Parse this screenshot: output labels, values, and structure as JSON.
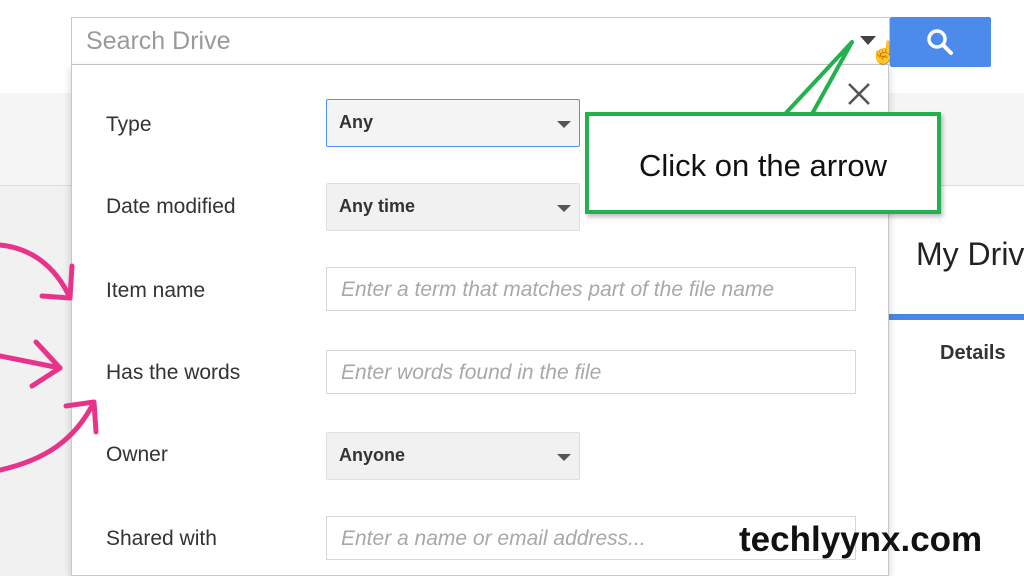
{
  "search": {
    "placeholder": "Search Drive",
    "icons": {
      "options_arrow": "caret-down-icon",
      "cursor": "hand-pointer-icon",
      "submit": "search-icon"
    },
    "button_color": "#4d8bea"
  },
  "advanced_search": {
    "close_icon": "close-icon",
    "fields": {
      "type": {
        "label": "Type",
        "value": "Any"
      },
      "date_modified": {
        "label": "Date modified",
        "value": "Any time"
      },
      "item_name": {
        "label": "Item name",
        "placeholder": "Enter a term that matches part of the file name"
      },
      "has_words": {
        "label": "Has the words",
        "placeholder": "Enter words found in the file"
      },
      "owner": {
        "label": "Owner",
        "value": "Anyone"
      },
      "shared_with": {
        "label": "Shared with",
        "placeholder": "Enter a name or email address..."
      }
    }
  },
  "background": {
    "title": "My Drive",
    "details_label": "Details",
    "accent_color": "#4a86e8"
  },
  "annotation": {
    "callout_text": "Click on the arrow",
    "callout_color": "#22b14c",
    "arrow_color": "#e8338b"
  },
  "watermark": "techlyynx.com"
}
